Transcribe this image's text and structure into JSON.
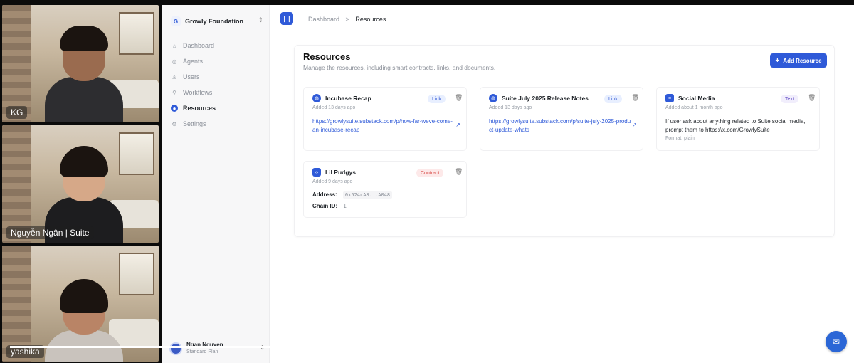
{
  "participants": [
    {
      "name": "KG"
    },
    {
      "name": "Nguyễn Ngân | Suite"
    },
    {
      "name": "yashika"
    }
  ],
  "sidebar": {
    "org": {
      "initial": "G",
      "name": "Growly Foundation"
    },
    "items": [
      {
        "label": "Dashboard",
        "icon": "home-icon",
        "active": false
      },
      {
        "label": "Agents",
        "icon": "agents-icon",
        "active": false
      },
      {
        "label": "Users",
        "icon": "user-icon",
        "active": false
      },
      {
        "label": "Workflows",
        "icon": "workflow-icon",
        "active": false
      },
      {
        "label": "Resources",
        "icon": "resources-icon",
        "active": true
      },
      {
        "label": "Settings",
        "icon": "gear-icon",
        "active": false
      }
    ],
    "user": {
      "name": "Ngan Nguyen",
      "plan": "Standard Plan"
    }
  },
  "header": {
    "breadcrumb": {
      "parent": "Dashboard",
      "separator": ">",
      "current": "Resources"
    }
  },
  "page": {
    "title": "Resources",
    "subtitle": "Manage the resources, including smart contracts, links, and documents.",
    "add_button": "Add Resource"
  },
  "resources": [
    {
      "title": "Incubase Recap",
      "type": "Link",
      "added": "Added 13 days ago",
      "url": "https://growlysuite.substack.com/p/how-far-weve-come-an-incubase-recap"
    },
    {
      "title": "Suite July 2025 Release Notes",
      "type": "Link",
      "added": "Added 13 days ago",
      "url": "https://growlysuite.substack.com/p/suite-july-2025-product-update-whats"
    },
    {
      "title": "Social Media",
      "type": "Text",
      "added": "Added about 1 month ago",
      "body": "If user ask about anything related to Suite social media, prompt them to https://x.com/GrowlySuite",
      "format": "Format: plain"
    },
    {
      "title": "Lil Pudgys",
      "type": "Contract",
      "added": "Added 9 days ago",
      "address_label": "Address:",
      "address": "0x524cA8...A048",
      "chain_label": "Chain ID:",
      "chain": "1"
    }
  ],
  "colors": {
    "accent": "#2f5ad8",
    "link_badge": "#e8efff",
    "text_badge": "#f1eefc",
    "contract_badge": "#fde9e9"
  },
  "video_progress": 0.93
}
